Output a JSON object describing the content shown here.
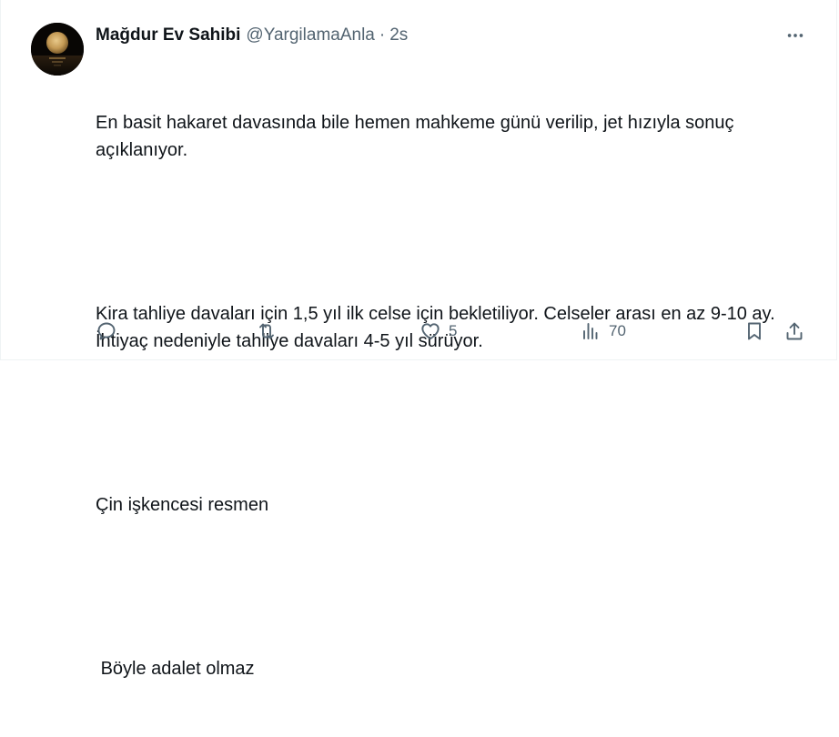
{
  "author": {
    "display_name": "Mağdur Ev Sahibi",
    "handle": "@YargilamaAnla",
    "separator": "·",
    "time": "2s",
    "avatar_icon": "moon-over-sea-avatar"
  },
  "menu": {
    "more_icon": "more-horizontal-icon"
  },
  "body": {
    "paragraphs": [
      "En basit hakaret davasında bile hemen mahkeme günü verilip, jet hızıyla sonuç açıklanıyor.",
      "Kira tahliye davaları için 1,5 yıl ilk celse için bekletiliyor. Celseler arası en az 9-10 ay. İhtiyaç nedeniyle tahliye davaları 4-5 yıl sürüyor.",
      "Çin işkencesi resmen",
      " Böyle adalet olmaz"
    ]
  },
  "actions": {
    "reply": {
      "icon": "reply-icon",
      "count": ""
    },
    "retweet": {
      "icon": "retweet-icon",
      "count": ""
    },
    "like": {
      "icon": "heart-icon",
      "count": "5"
    },
    "views": {
      "icon": "analytics-icon",
      "count": "70"
    },
    "bookmark": {
      "icon": "bookmark-icon"
    },
    "share": {
      "icon": "share-icon"
    }
  },
  "colors": {
    "text_primary": "#0f1419",
    "text_secondary": "#536471",
    "border": "#eff3f4"
  }
}
